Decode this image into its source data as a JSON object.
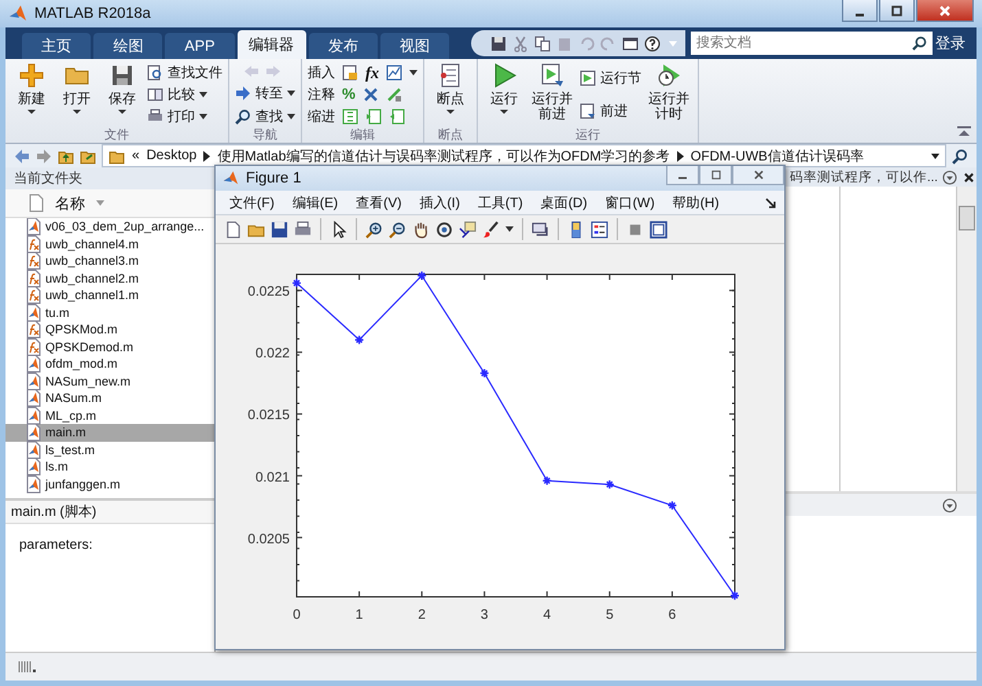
{
  "window": {
    "title": "MATLAB R2018a"
  },
  "tabs": [
    {
      "label": "主页",
      "selected": false
    },
    {
      "label": "绘图",
      "selected": false
    },
    {
      "label": "APP",
      "selected": false
    },
    {
      "label": "编辑器",
      "selected": true
    },
    {
      "label": "发布",
      "selected": false
    },
    {
      "label": "视图",
      "selected": false
    }
  ],
  "search": {
    "placeholder": "搜索文档"
  },
  "login": "登录",
  "ribbon": {
    "file": {
      "label": "文件",
      "new": "新建",
      "open": "打开",
      "save": "保存",
      "find_files": "查找文件",
      "compare": "比较",
      "print": "打印"
    },
    "navigate": {
      "label": "导航",
      "goto": "转至",
      "find": "查找"
    },
    "edit": {
      "label": "编辑",
      "insert": "插入",
      "fx": "fx",
      "comment": "注释",
      "percent": "%",
      "indent": "缩进"
    },
    "breakpoints": {
      "label": "断点",
      "button": "断点"
    },
    "run": {
      "label": "运行",
      "run": "运行",
      "run_advance": "运行并前进",
      "run_section": "运行节",
      "advance": "前进",
      "run_time": "运行并计时"
    }
  },
  "address": {
    "back": "«",
    "crumbs": [
      "Desktop",
      "使用Matlab编写的信道估计与误码率测试程序，可以作为OFDM学习的参考",
      "OFDM-UWB信道估计误码率"
    ]
  },
  "current_folder": {
    "title": "当前文件夹",
    "column": "名称",
    "files": [
      {
        "name": "v06_03_dem_2up_arrange...",
        "kind": "script",
        "selected": false
      },
      {
        "name": "uwb_channel4.m",
        "kind": "function",
        "selected": false
      },
      {
        "name": "uwb_channel3.m",
        "kind": "function",
        "selected": false
      },
      {
        "name": "uwb_channel2.m",
        "kind": "function",
        "selected": false
      },
      {
        "name": "uwb_channel1.m",
        "kind": "function",
        "selected": false
      },
      {
        "name": "tu.m",
        "kind": "script",
        "selected": false
      },
      {
        "name": "QPSKMod.m",
        "kind": "function",
        "selected": false
      },
      {
        "name": "QPSKDemod.m",
        "kind": "function",
        "selected": false
      },
      {
        "name": "ofdm_mod.m",
        "kind": "script",
        "selected": false
      },
      {
        "name": "NASum_new.m",
        "kind": "script",
        "selected": false
      },
      {
        "name": "NASum.m",
        "kind": "script",
        "selected": false
      },
      {
        "name": "ML_cp.m",
        "kind": "script",
        "selected": false
      },
      {
        "name": "main.m",
        "kind": "script",
        "selected": true
      },
      {
        "name": "ls_test.m",
        "kind": "script",
        "selected": false
      },
      {
        "name": "ls.m",
        "kind": "script",
        "selected": false
      },
      {
        "name": "junfanggen.m",
        "kind": "script",
        "selected": false
      }
    ]
  },
  "details": {
    "title": "main.m  (脚本)",
    "text": "parameters:"
  },
  "editor": {
    "title": "码率测试程序，可以作..."
  },
  "figure": {
    "title": "Figure 1",
    "menu": [
      "文件(F)",
      "编辑(E)",
      "查看(V)",
      "插入(I)",
      "工具(T)",
      "桌面(D)",
      "窗口(W)",
      "帮助(H)"
    ],
    "chart_data": {
      "type": "line",
      "x": [
        0,
        1,
        2,
        3,
        4,
        5,
        6,
        7
      ],
      "series": [
        {
          "color": "#2a2aff",
          "marker": "cross",
          "values": [
            0.02256,
            0.0221,
            0.02262,
            0.02183,
            0.02096,
            0.02093,
            0.02076,
            0.02003
          ]
        }
      ],
      "xlim": [
        0,
        7
      ],
      "ylim": [
        0.02002,
        0.02263
      ],
      "xticks": [
        0,
        1,
        2,
        3,
        4,
        5,
        6
      ],
      "yticks": [
        {
          "value": 0.0205,
          "label": "0.0205"
        },
        {
          "value": 0.021,
          "label": "0.021"
        },
        {
          "value": 0.0215,
          "label": "0.0215"
        },
        {
          "value": 0.022,
          "label": "0.022"
        },
        {
          "value": 0.0225,
          "label": "0.0225"
        }
      ]
    }
  }
}
